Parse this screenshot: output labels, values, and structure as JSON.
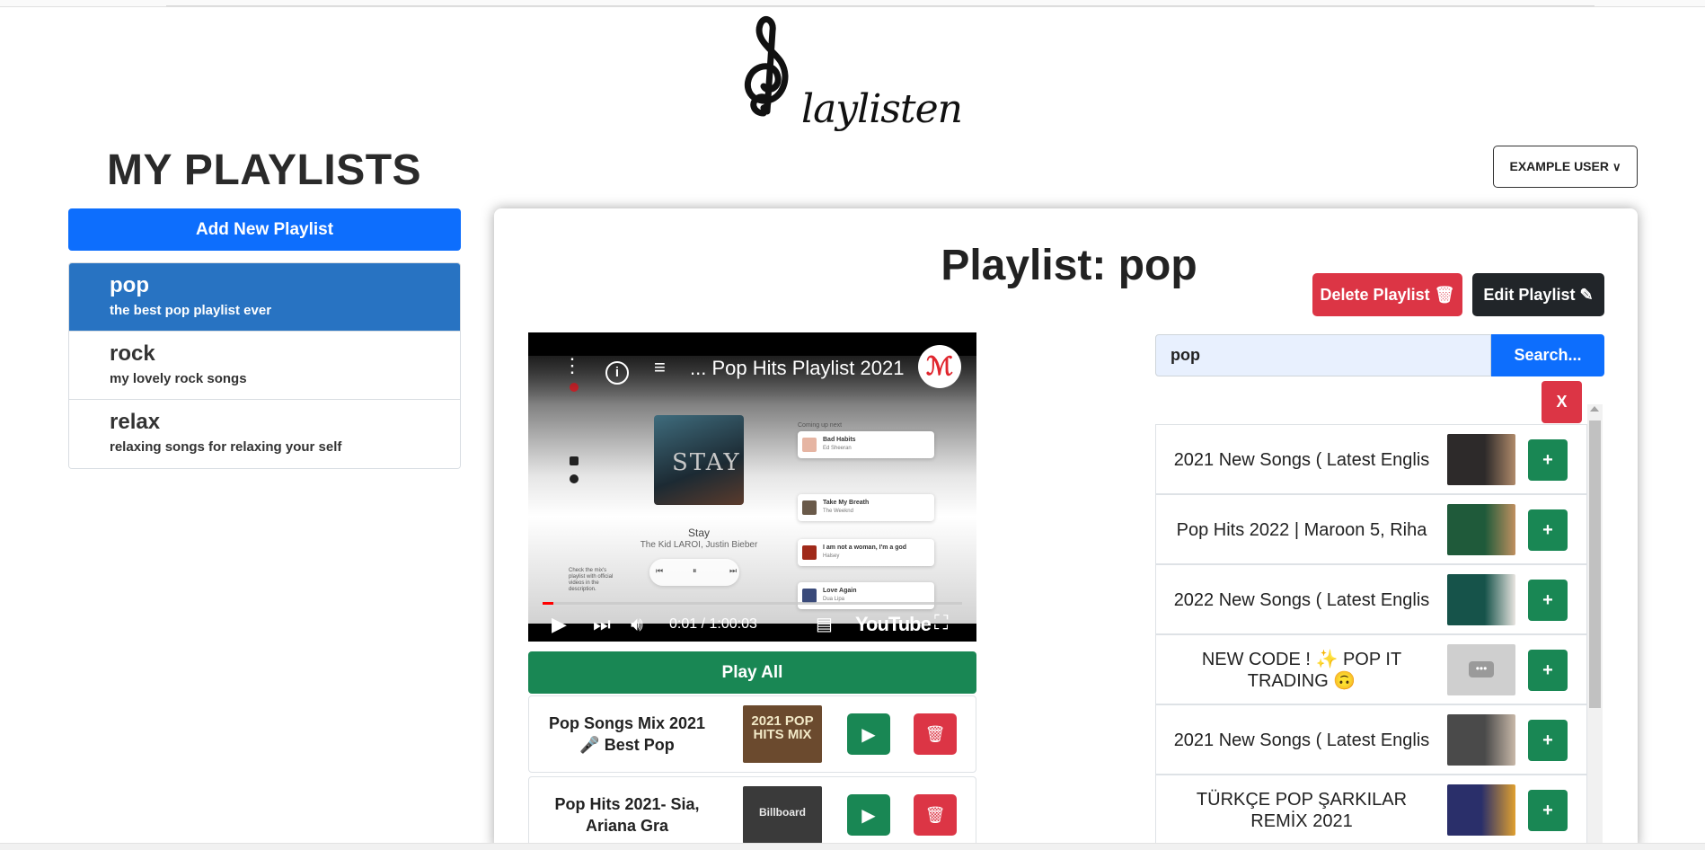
{
  "app": {
    "logo_text": "laylisten"
  },
  "sidebar": {
    "title": "MY PLAYLISTS",
    "add_button": "Add New Playlist",
    "playlists": [
      {
        "name": "pop",
        "description": "the best pop playlist ever",
        "active": true
      },
      {
        "name": "rock",
        "description": "my lovely rock songs",
        "active": false
      },
      {
        "name": "relax",
        "description": "relaxing songs for relaxing your self",
        "active": false
      }
    ]
  },
  "user_menu": {
    "label": "EXAMPLE USER"
  },
  "playlist": {
    "heading": "Playlist: pop",
    "delete_button": "Delete Playlist",
    "edit_button": "Edit Playlist",
    "play_all": "Play All"
  },
  "player": {
    "title": "... Pop Hits Playlist 2021",
    "time": "0:01 / 1:00:03",
    "brand": "YouTube",
    "progress_fraction": 0.0003,
    "now_playing": {
      "album_art_text": "STAY",
      "song": "Stay",
      "artist": "The Kid LAROI, Justin Bieber"
    },
    "up_next_label": "Coming up next",
    "up_next": [
      {
        "song": "Bad Habits",
        "artist": "Ed Sheeran",
        "color": "#e6b5a3"
      },
      {
        "song": "Take My Breath",
        "artist": "The Weeknd",
        "color": "#6a5a4a"
      },
      {
        "song": "I am not a woman, I'm a god",
        "artist": "Halsey",
        "color": "#a02a1a"
      },
      {
        "song": "Love Again",
        "artist": "Dua Lipa",
        "color": "#3a4a7a"
      }
    ],
    "mix_note": "Check the mix's playlist with official videos in the description."
  },
  "songs": [
    {
      "title": "Pop Songs Mix 2021 🎤 Best Pop",
      "thumb_text": "2021 POP HITS MIX",
      "thumb_color": "#6b4a2e"
    },
    {
      "title": "Pop Hits 2021- Sia, Ariana Gra",
      "thumb_text": "Billboard",
      "thumb_color": "#3a3a3a"
    }
  ],
  "search": {
    "value": "pop",
    "button": "Search...",
    "clear_button": "X"
  },
  "results": [
    {
      "title": "2021 New Songs ( Latest Englis",
      "thumb_color": "#2d2a2a"
    },
    {
      "title": "Pop Hits 2022 | Maroon 5, Riha",
      "thumb_color": "#1f5a3a"
    },
    {
      "title": "2022 New Songs ( Latest Englis",
      "thumb_color": "#16534a"
    },
    {
      "title": "NEW CODE ! ✨ POP IT\nTRADING 🙃",
      "thumb_color": "#cfcfcf"
    },
    {
      "title": "2021 New Songs ( Latest Englis",
      "thumb_color": "#4a4a4a"
    },
    {
      "title": "TÜRKÇE POP ŞARKILAR\nREMİX 2021",
      "thumb_color": "#2a2f6a"
    }
  ],
  "add_label": "+",
  "colors": {
    "primary": "#0d6efd",
    "success": "#198754",
    "danger": "#dc3545",
    "dark": "#212529",
    "active_item": "#2873c2"
  }
}
